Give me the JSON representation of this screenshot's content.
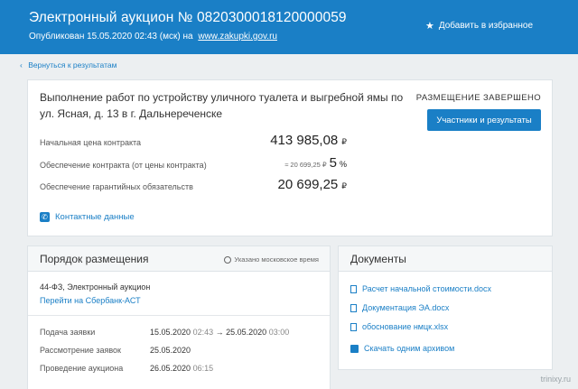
{
  "header": {
    "title": "Электронный аукцион № 0820300018120000059",
    "published_label": "Опубликован",
    "published_date": "15.05.2020 02:43 (мск)",
    "published_on": "на",
    "site_link": "www.zakupki.gov.ru",
    "favorite_label": "Добавить в избранное"
  },
  "nav": {
    "back_label": "Вернуться к результатам"
  },
  "lot": {
    "title": "Выполнение работ по устройству уличного туалета и выгребной ямы по ул. Ясная, д. 13  в г. Дальнереченске",
    "status": "РАЗМЕЩЕНИЕ ЗАВЕРШЕНО",
    "results_button": "Участники и результаты",
    "currency": "₽",
    "rows": [
      {
        "label": "Начальная цена контракта",
        "value": "413 985,08"
      },
      {
        "label": "Обеспечение контракта (от цены контракта)",
        "approx": "≈ 20 699,25 ₽",
        "value": "5",
        "unit": "%"
      },
      {
        "label": "Обеспечение гарантийных обязательств",
        "value": "20 699,25"
      }
    ],
    "contacts_label": "Контактные данные"
  },
  "order": {
    "heading": "Порядок размещения",
    "time_note": "Указано московское время",
    "law": "44-ФЗ, Электронный аукцион",
    "platform_link": "Перейти на Сбербанк-АСТ",
    "dates": [
      {
        "label": "Подача заявки",
        "value": "15.05.2020",
        "time": "02:43",
        "sep": "→",
        "end": "25.05.2020",
        "end_time": "03:00"
      },
      {
        "label": "Рассмотрение заявок",
        "value": "25.05.2020",
        "time": ""
      },
      {
        "label": "Проведение аукциона",
        "value": "26.05.2020",
        "time": "06:15"
      }
    ]
  },
  "documents": {
    "heading": "Документы",
    "files": [
      {
        "name": "Расчет начальной стоимости.docx"
      },
      {
        "name": "Документация ЭА.docx"
      },
      {
        "name": "обоснование нмцк.xlsx"
      }
    ],
    "archive_label": "Скачать одним архивом"
  },
  "watermark": "trinixy.ru",
  "colors": {
    "brand": "#1a7fc6",
    "background": "#eceff1"
  }
}
